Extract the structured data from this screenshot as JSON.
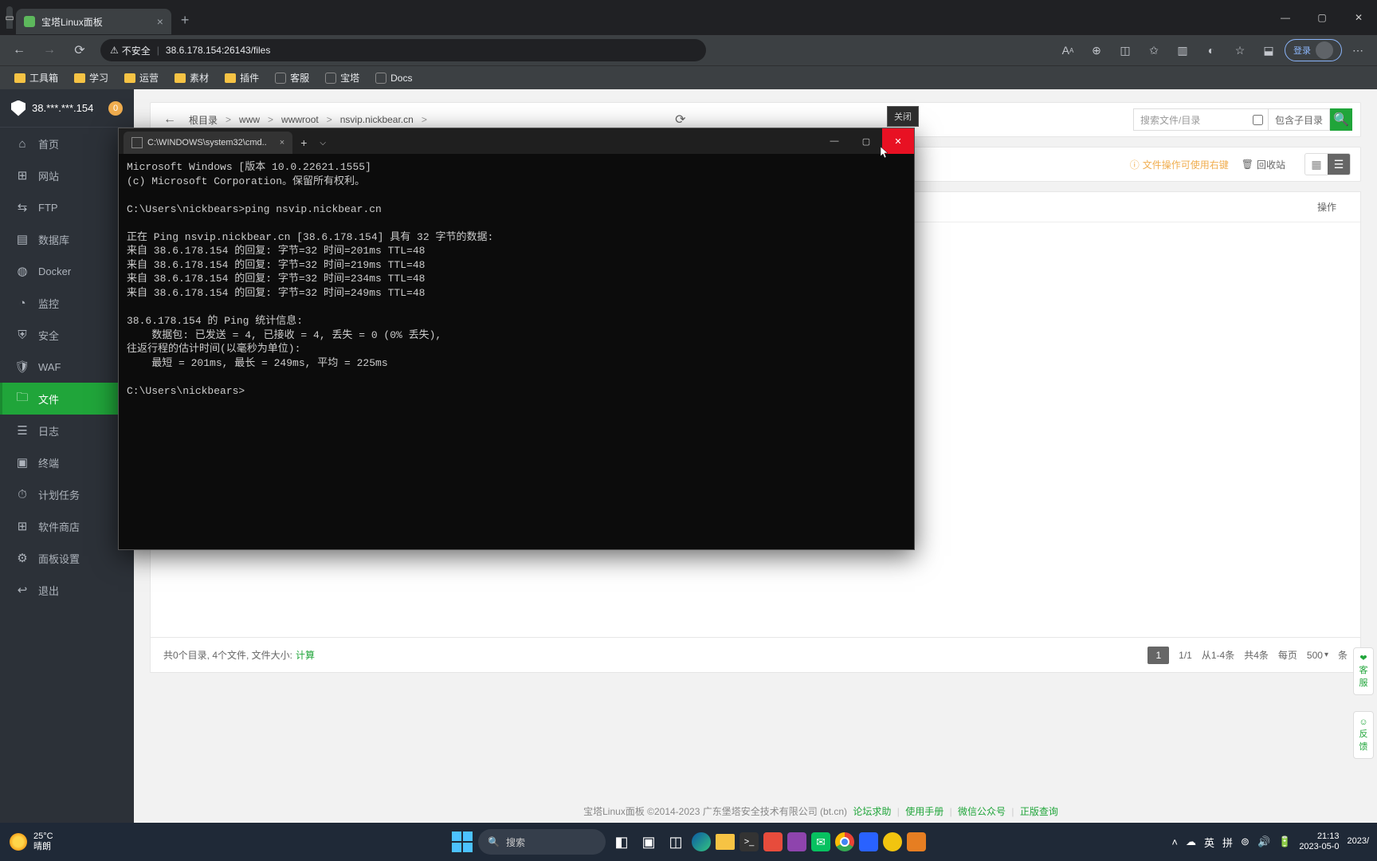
{
  "browser": {
    "tab_title": "宝塔Linux面板",
    "addr_warning": "不安全",
    "url": "38.6.178.154:26143/files",
    "login_label": "登录",
    "bookmarks": [
      {
        "label": "工具箱",
        "type": "folder"
      },
      {
        "label": "学习",
        "type": "folder"
      },
      {
        "label": "运营",
        "type": "folder"
      },
      {
        "label": "素材",
        "type": "folder"
      },
      {
        "label": "插件",
        "type": "folder"
      },
      {
        "label": "客服",
        "type": "link"
      },
      {
        "label": "宝塔",
        "type": "link"
      },
      {
        "label": "Docs",
        "type": "link"
      }
    ]
  },
  "baota": {
    "ip": "38.***.***.154",
    "badge": "0",
    "menu": [
      {
        "icon": "⌂",
        "label": "首页"
      },
      {
        "icon": "⊞",
        "label": "网站"
      },
      {
        "icon": "⇆",
        "label": "FTP"
      },
      {
        "icon": "▤",
        "label": "数据库"
      },
      {
        "icon": "◍",
        "label": "Docker"
      },
      {
        "icon": "◔",
        "label": "监控"
      },
      {
        "icon": "⛨",
        "label": "安全"
      },
      {
        "icon": "🛡",
        "label": "WAF"
      },
      {
        "icon": "🗀",
        "label": "文件",
        "active": true
      },
      {
        "icon": "☰",
        "label": "日志"
      },
      {
        "icon": "▣",
        "label": "终端"
      },
      {
        "icon": "⏱",
        "label": "计划任务"
      },
      {
        "icon": "⊞",
        "label": "软件商店"
      },
      {
        "icon": "⚙",
        "label": "面板设置"
      },
      {
        "icon": "↩",
        "label": "退出"
      }
    ],
    "breadcrumb": [
      "根目录",
      "www",
      "wwwroot",
      "nsvip.nickbear.cn"
    ],
    "search_placeholder": "搜索文件/目录",
    "include_subdir": "包含子目录",
    "warn_text": "文件操作可使用右键",
    "trash": "回收站",
    "th_op": "操作",
    "footer_summary": "共0个目录, 4个文件, 文件大小:",
    "calc": "计算",
    "page_current": "1",
    "page_total": "1/1",
    "page_range": "从1-4条",
    "page_count": "共4条",
    "per_page_label": "每页",
    "per_page_value": "500",
    "per_page_unit": "条",
    "copyright": "宝塔Linux面板 ©2014-2023 广东堡塔安全技术有限公司 (bt.cn)",
    "links": [
      "论坛求助",
      "使用手册",
      "微信公众号",
      "正版查询"
    ],
    "float1": "❤\n客\n服",
    "float2": "☺\n反\n馈"
  },
  "cmd": {
    "tab_title": "C:\\WINDOWS\\system32\\cmd..",
    "tooltip": "关闭",
    "output": "Microsoft Windows [版本 10.0.22621.1555]\n(c) Microsoft Corporation。保留所有权利。\n\nC:\\Users\\nickbears>ping nsvip.nickbear.cn\n\n正在 Ping nsvip.nickbear.cn [38.6.178.154] 具有 32 字节的数据:\n来自 38.6.178.154 的回复: 字节=32 时间=201ms TTL=48\n来自 38.6.178.154 的回复: 字节=32 时间=219ms TTL=48\n来自 38.6.178.154 的回复: 字节=32 时间=234ms TTL=48\n来自 38.6.178.154 的回复: 字节=32 时间=249ms TTL=48\n\n38.6.178.154 的 Ping 统计信息:\n    数据包: 已发送 = 4, 已接收 = 4, 丢失 = 0 (0% 丢失),\n往返行程的估计时间(以毫秒为单位):\n    最短 = 201ms, 最长 = 249ms, 平均 = 225ms\n\nC:\\Users\\nickbears>"
  },
  "taskbar": {
    "weather_temp": "25°C",
    "weather_desc": "晴朗",
    "search_placeholder": "搜索",
    "ime_lang": "英",
    "ime_mode": "拼",
    "time": "21:13",
    "date1": "2023-05-0",
    "date2": "2023/"
  }
}
